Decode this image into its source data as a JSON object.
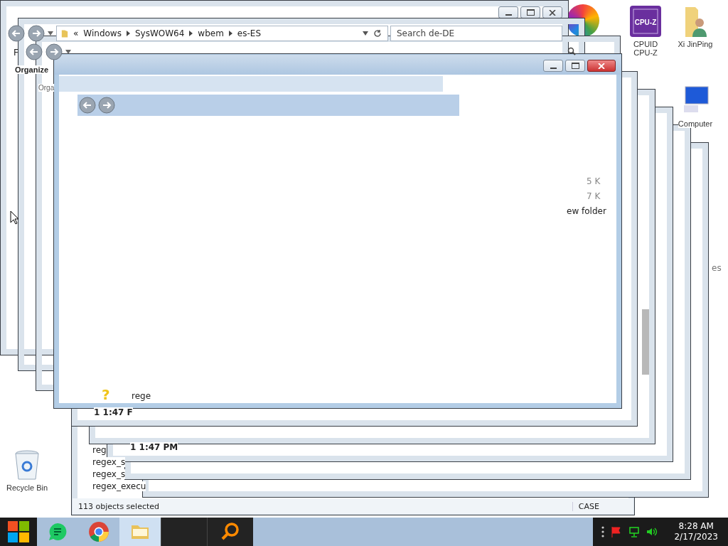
{
  "explorer_window": {
    "menu": "F",
    "toolbar": "Organize",
    "address_prefix": "«",
    "address": [
      "Windows",
      "SysWOW64",
      "wbem",
      "es-ES"
    ],
    "search": {
      "placeholder": "Search de-DE"
    }
  },
  "second_window": {
    "toolbar": "Orga"
  },
  "status_window": {
    "status": "113 objects selected",
    "mode": "CASE"
  },
  "fragments": [
    {
      "kind": "size",
      "text": "5 K"
    },
    {
      "kind": "size",
      "text": "7 K"
    },
    {
      "kind": "name",
      "text": "ew folder"
    },
    {
      "kind": "name",
      "text": "rege"
    },
    {
      "kind": "time",
      "text": "1 1:47 F"
    },
    {
      "kind": "time",
      "text": "1 1:47 PM"
    },
    {
      "kind": "name",
      "text": "reg"
    },
    {
      "kind": "name",
      "text": "regex_s"
    },
    {
      "kind": "name",
      "text": "regex_s"
    },
    {
      "kind": "name",
      "text": "regex_execu"
    },
    {
      "kind": "label",
      "text": "es"
    },
    {
      "kind": "icon",
      "text": "?"
    }
  ],
  "desktop_icons": [
    {
      "kind": "cpu",
      "label": "CPUID CPU-Z",
      "logo_text": "CPU-Z"
    },
    {
      "kind": "user",
      "label": "Xi JinPing"
    },
    {
      "kind": "computer",
      "label": "Computer"
    },
    {
      "kind": "bin",
      "label": "Recycle Bin"
    }
  ],
  "taskbar": {
    "apps": [
      {
        "kind": "chat",
        "selected": false
      },
      {
        "kind": "browser",
        "selected": false
      },
      {
        "kind": "folder",
        "selected": true
      },
      {
        "kind": "blank",
        "selected": false
      },
      {
        "kind": "search",
        "selected": false
      }
    ],
    "time": "8:28 AM",
    "date": "2/17/2023"
  }
}
